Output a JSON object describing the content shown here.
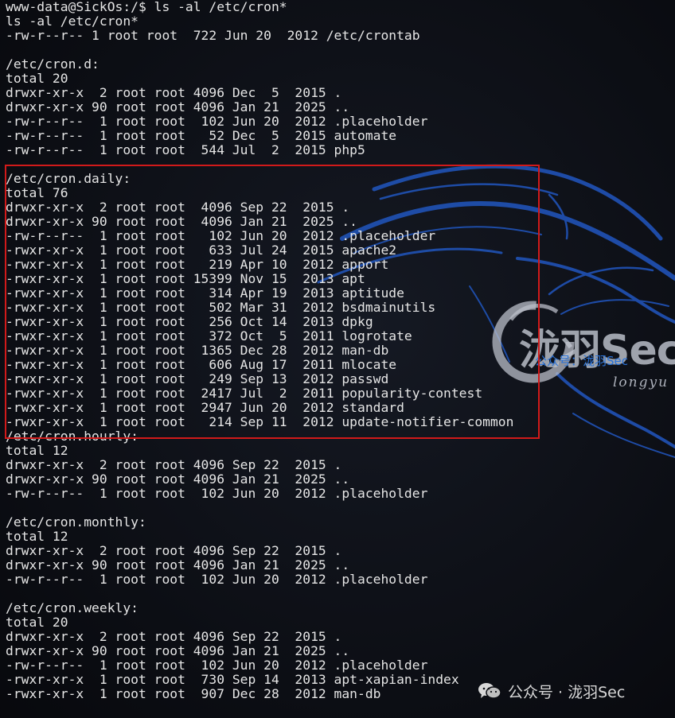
{
  "terminal": {
    "lines": [
      "www-data@SickOs:/$ ls -al /etc/cron*",
      "ls -al /etc/cron*",
      "-rw-r--r-- 1 root root  722 Jun 20  2012 /etc/crontab",
      "",
      "/etc/cron.d:",
      "total 20",
      "drwxr-xr-x  2 root root 4096 Dec  5  2015 .",
      "drwxr-xr-x 90 root root 4096 Jan 21  2025 ..",
      "-rw-r--r--  1 root root  102 Jun 20  2012 .placeholder",
      "-rw-r--r--  1 root root   52 Dec  5  2015 automate",
      "-rw-r--r--  1 root root  544 Jul  2  2015 php5",
      "",
      "/etc/cron.daily:",
      "total 76",
      "drwxr-xr-x  2 root root  4096 Sep 22  2015 .",
      "drwxr-xr-x 90 root root  4096 Jan 21  2025 ..",
      "-rw-r--r--  1 root root   102 Jun 20  2012 .placeholder",
      "-rwxr-xr-x  1 root root   633 Jul 24  2015 apache2",
      "-rwxr-xr-x  1 root root   219 Apr 10  2012 apport",
      "-rwxr-xr-x  1 root root 15399 Nov 15  2013 apt",
      "-rwxr-xr-x  1 root root   314 Apr 19  2013 aptitude",
      "-rwxr-xr-x  1 root root   502 Mar 31  2012 bsdmainutils",
      "-rwxr-xr-x  1 root root   256 Oct 14  2013 dpkg",
      "-rwxr-xr-x  1 root root   372 Oct  5  2011 logrotate",
      "-rwxr-xr-x  1 root root  1365 Dec 28  2012 man-db",
      "-rwxr-xr-x  1 root root   606 Aug 17  2011 mlocate",
      "-rwxr-xr-x  1 root root   249 Sep 13  2012 passwd",
      "-rwxr-xr-x  1 root root  2417 Jul  2  2011 popularity-contest",
      "-rwxr-xr-x  1 root root  2947 Jun 20  2012 standard",
      "-rwxr-xr-x  1 root root   214 Sep 11  2012 update-notifier-common",
      "/etc/cron.hourly:",
      "total 12",
      "drwxr-xr-x  2 root root 4096 Sep 22  2015 .",
      "drwxr-xr-x 90 root root 4096 Jan 21  2025 ..",
      "-rw-r--r--  1 root root  102 Jun 20  2012 .placeholder",
      "",
      "/etc/cron.monthly:",
      "total 12",
      "drwxr-xr-x  2 root root 4096 Sep 22  2015 .",
      "drwxr-xr-x 90 root root 4096 Jan 21  2025 ..",
      "-rw-r--r--  1 root root  102 Jun 20  2012 .placeholder",
      "",
      "/etc/cron.weekly:",
      "total 20",
      "drwxr-xr-x  2 root root 4096 Sep 22  2015 .",
      "drwxr-xr-x 90 root root 4096 Jan 21  2025 ..",
      "-rw-r--r--  1 root root  102 Jun 20  2012 .placeholder",
      "-rwxr-xr-x  1 root root  730 Sep 14  2013 apt-xapian-index",
      "-rwxr-xr-x  1 root root  907 Dec 28  2012 man-db"
    ]
  },
  "highlight": {
    "color": "#d11a1a"
  },
  "watermark": {
    "brand": "泷羽Sec",
    "subtitle": "公众号：泷羽Sec",
    "script": "longyu",
    "footer_text": "公众号 · 泷羽Sec",
    "footer_icon": "wechat-icon"
  },
  "colors": {
    "background": "#0b0d12",
    "text": "#e6e6e6",
    "dragon_stroke": "#1f4fae",
    "watermark_blue": "#2a73d9"
  }
}
